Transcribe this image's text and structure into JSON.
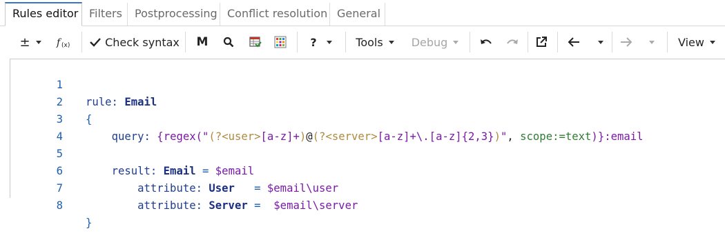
{
  "tabs": [
    "Rules editor",
    "Filters",
    "Postprocessing",
    "Conflict resolution",
    "General"
  ],
  "toolbar": {
    "plus_minus": "±",
    "fx": "fx",
    "check_syntax": "Check syntax",
    "m": "M",
    "help": "?",
    "tools": "Tools",
    "debug": "Debug",
    "view": "View"
  },
  "editor": {
    "line_numbers": [
      "1",
      "2",
      "3",
      "4",
      "5",
      "6",
      "7",
      "8"
    ],
    "lines": {
      "l1": {
        "kw": "rule:",
        "name": "Email"
      },
      "l2": {
        "brace": "{"
      },
      "l3": {
        "indent": "    ",
        "kw": "query:",
        "t1": "{",
        "t2": "regex",
        "t3": "(",
        "t4": "\"",
        "t5": "(?<",
        "t6": "user",
        "t7": ">",
        "t8": "[a-z]+",
        "t9": ")",
        "t10": "@",
        "t11": "(?<",
        "t12": "server",
        "t13": ">",
        "t14": "[a-z]+\\.[a-z]{2,3}",
        "t15": ")",
        "t16": "\"",
        "t17": ", ",
        "t18": "scope:=text",
        "t19": ")",
        "t20": "}",
        "t21": ":email"
      },
      "l5": {
        "indent": "    ",
        "kw": "result:",
        "name": "Email",
        "eq": " = ",
        "val": "$email"
      },
      "l6": {
        "indent": "        ",
        "kw": "attribute:",
        "name": "User",
        "eq": "   = ",
        "val": "$email\\user"
      },
      "l7": {
        "indent": "        ",
        "kw": "attribute:",
        "name": "Server",
        "eq": " =  ",
        "val": "$email\\server"
      },
      "l8": {
        "brace": "}"
      }
    }
  },
  "colors": {
    "accent_tab": "#3a75c4",
    "keyword": "#1f3e8f",
    "variable": "#7a1aa8",
    "line_number": "#1e5fae"
  }
}
